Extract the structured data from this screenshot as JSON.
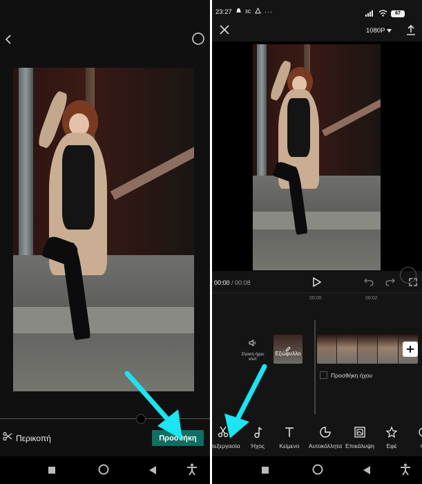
{
  "left_panel": {
    "trim_label": "Περικοπή",
    "add_button_label": "Προσθήκη"
  },
  "right_panel": {
    "status_bar": {
      "time": "23:27",
      "extra": "3C",
      "battery": "67"
    },
    "resolution": "1080P",
    "time_current": "00:00",
    "time_total": "/ 00:08",
    "ruler": [
      "00:00",
      "00:02"
    ],
    "audio_side_label": "Σίγαση ήχου κλιπ",
    "cover_label": "Εξώφυλλο",
    "add_audio_label": "Προσθήκη ήχου",
    "tools": [
      {
        "label": "Επεξεργασία",
        "icon": "scissors-icon"
      },
      {
        "label": "Ήχος",
        "icon": "music-note-icon"
      },
      {
        "label": "Κείμενο",
        "icon": "text-icon"
      },
      {
        "label": "Αυτοκόλλητα",
        "icon": "sticker-icon"
      },
      {
        "label": "Επικάλυψη",
        "icon": "overlay-icon"
      },
      {
        "label": "Εφέ",
        "icon": "effects-icon"
      },
      {
        "label": "Φί",
        "icon": "filter-icon"
      }
    ]
  },
  "colors": {
    "add_button_bg": "#0f6f63",
    "arrow": "#1ce4f0",
    "background": "#101010"
  }
}
